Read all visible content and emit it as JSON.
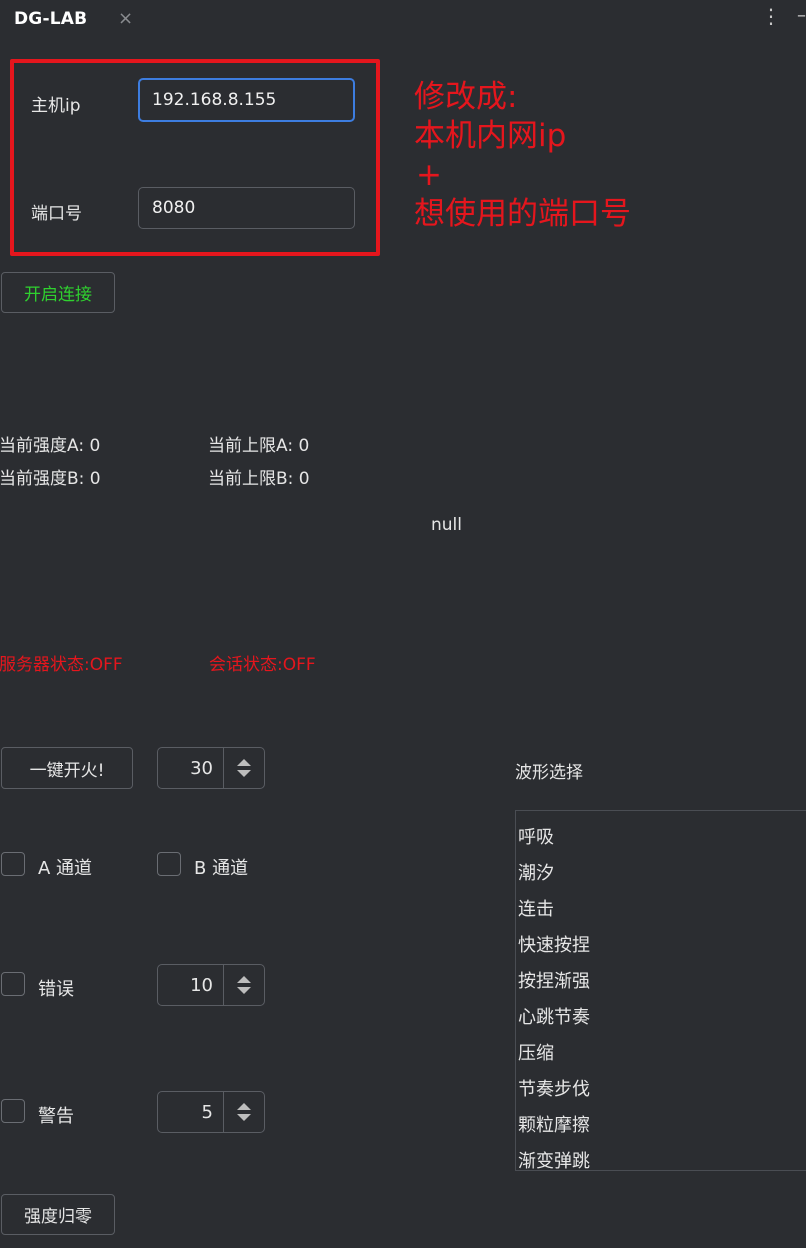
{
  "tab": {
    "title": "DG-LAB",
    "close_glyph": "×",
    "menu_glyph": "⋮",
    "minimize_glyph": "–"
  },
  "connection": {
    "host_label": "主机ip",
    "host_value": "192.168.8.155",
    "port_label": "端口号",
    "port_value": "8080"
  },
  "annotation": {
    "color": "#e5161d",
    "lines": [
      "修改成:",
      "本机内网ip",
      "+",
      "想使用的端口号"
    ]
  },
  "buttons": {
    "connect_label": "开启连接",
    "fire_label": "一键开火!",
    "reset_label": "强度归零"
  },
  "stats": {
    "strength_a": "当前强度A: 0",
    "strength_b": "当前强度B: 0",
    "limit_a": "当前上限A: 0",
    "limit_b": "当前上限B: 0",
    "message": "null",
    "server_status": "服务器状态:OFF",
    "session_status": "会话状态:OFF"
  },
  "fire": {
    "value": "30"
  },
  "channels": {
    "a_label": "A 通道",
    "b_label": "B 通道"
  },
  "error": {
    "label": "错误",
    "value": "10"
  },
  "warning": {
    "label": "警告",
    "value": "5"
  },
  "waveform": {
    "title": "波形选择",
    "items": [
      "呼吸",
      "潮汐",
      "连击",
      "快速按捏",
      "按捏渐强",
      "心跳节奏",
      "压缩",
      "节奏步伐",
      "颗粒摩擦",
      "渐变弹跳"
    ]
  },
  "colors": {
    "background": "#2b2d31",
    "connect_text": "#2fd12f",
    "status_red": "#e5161d",
    "focus_border": "#3d7de0"
  }
}
